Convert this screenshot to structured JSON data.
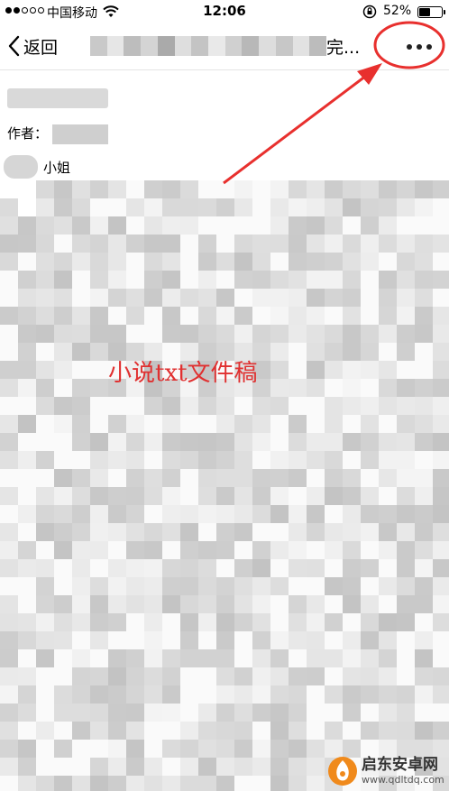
{
  "status_bar": {
    "carrier": "中国移动",
    "time": "12:06",
    "battery_percent": "52%",
    "battery_level": 0.52
  },
  "nav": {
    "back_label": "返回",
    "title_visible_fragment": "完...",
    "more_icon": "ellipsis-horizontal-icon"
  },
  "header": {
    "author_label": "作者：",
    "name_suffix": "小姐"
  },
  "content": {
    "caption": "小说txt文件稿"
  },
  "annotation": {
    "color": "#e8302e"
  },
  "watermark": {
    "name": "启东安卓网",
    "url": "www.qdltdq.com"
  }
}
